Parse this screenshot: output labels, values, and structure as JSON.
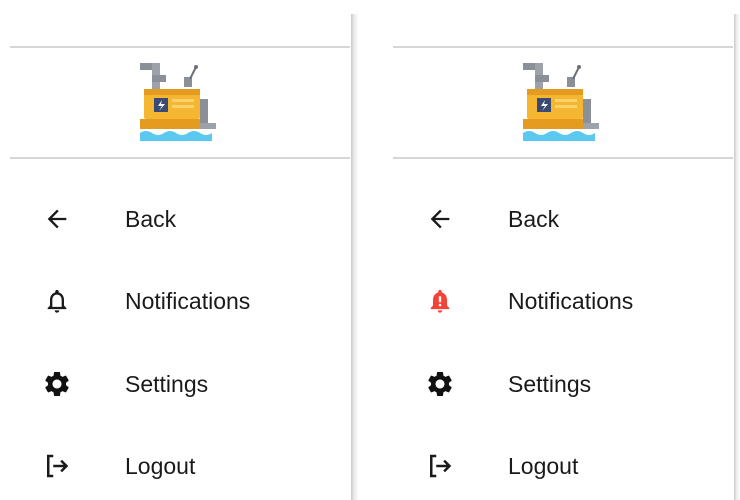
{
  "drawers": [
    {
      "id": "left",
      "items": [
        {
          "label": "Back",
          "icon": "arrow-back-icon"
        },
        {
          "label": "Notifications",
          "icon": "bell-outline-icon"
        },
        {
          "label": "Settings",
          "icon": "gear-icon"
        },
        {
          "label": "Logout",
          "icon": "logout-icon"
        }
      ]
    },
    {
      "id": "right",
      "items": [
        {
          "label": "Back",
          "icon": "arrow-back-icon"
        },
        {
          "label": "Notifications",
          "icon": "bell-alert-icon"
        },
        {
          "label": "Settings",
          "icon": "gear-icon"
        },
        {
          "label": "Logout",
          "icon": "logout-icon"
        }
      ]
    }
  ],
  "colors": {
    "text": "#1a1a1a",
    "alert": "#f44336",
    "divider": "#d6d6d6",
    "logo_body": "#f5b731",
    "logo_water": "#5bc8ef"
  }
}
